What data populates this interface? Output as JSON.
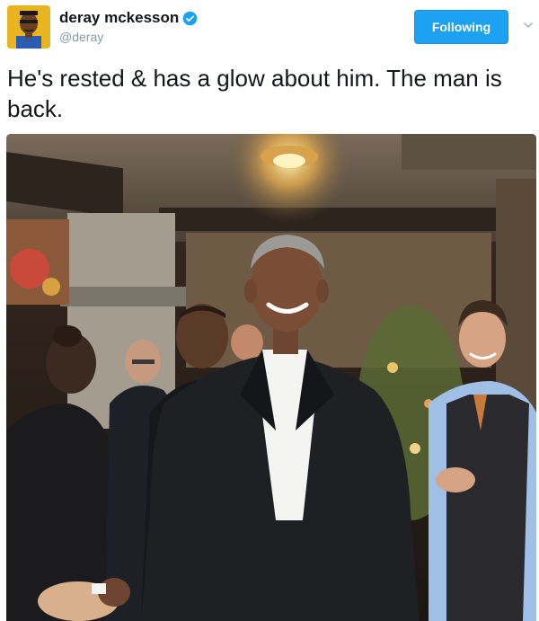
{
  "user": {
    "display_name": "deray mckesson",
    "handle": "@deray",
    "verified": true,
    "avatar_icon": "cartoon-avatar-icon",
    "avatar_bg": "#e8b521"
  },
  "actions": {
    "follow_label": "Following",
    "follow_color": "#1da1f2",
    "menu_icon": "chevron-down-icon"
  },
  "tweet": {
    "text": "He's rested & has a glow about him. The man is back."
  },
  "media": {
    "icon": "photo-icon"
  }
}
